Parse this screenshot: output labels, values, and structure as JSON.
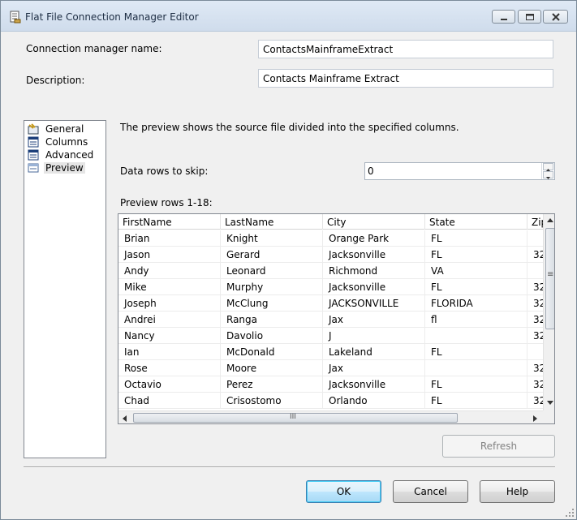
{
  "window": {
    "title": "Flat File Connection Manager Editor"
  },
  "form": {
    "connection_name_label": "Connection manager name:",
    "connection_name_value": "ContactsMainframeExtract",
    "description_label": "Description:",
    "description_value": "Contacts Mainframe Extract"
  },
  "nav": {
    "items": [
      {
        "label": "General",
        "icon": "general-icon"
      },
      {
        "label": "Columns",
        "icon": "columns-icon"
      },
      {
        "label": "Advanced",
        "icon": "advanced-icon"
      },
      {
        "label": "Preview",
        "icon": "preview-icon"
      }
    ],
    "selected": "Preview"
  },
  "preview": {
    "intro": "The preview shows the source file divided into the specified columns.",
    "skip_label": "Data rows to skip:",
    "skip_value": "0",
    "rows_label": "Preview rows 1-18:",
    "columns": [
      "FirstName",
      "LastName",
      "City",
      "State",
      "Zip"
    ],
    "rows": [
      [
        "Brian",
        "Knight",
        "Orange Park",
        "FL",
        ""
      ],
      [
        "Jason",
        "Gerard",
        "Jacksonville",
        "FL",
        "32"
      ],
      [
        "Andy",
        "Leonard",
        "Richmond",
        "VA",
        ""
      ],
      [
        "Mike",
        "Murphy",
        "Jacksonville",
        "FL",
        "32"
      ],
      [
        "Joseph",
        "McClung",
        "JACKSONVILLE",
        "FLORIDA",
        "32"
      ],
      [
        "Andrei",
        "Ranga",
        "Jax",
        "fl",
        "32"
      ],
      [
        "Nancy",
        "Davolio",
        "J",
        "",
        "32"
      ],
      [
        "Ian",
        "McDonald",
        "Lakeland",
        "FL",
        ""
      ],
      [
        "Rose",
        "Moore",
        "Jax",
        "",
        "32"
      ],
      [
        "Octavio",
        "Perez",
        "Jacksonville",
        "FL",
        "32"
      ],
      [
        "Chad",
        "Crisostomo",
        "Orlando",
        "FL",
        "32"
      ]
    ],
    "hscroll_glyph": "III",
    "vscroll_glyph": "≡"
  },
  "buttons": {
    "refresh": "Refresh",
    "ok": "OK",
    "cancel": "Cancel",
    "help": "Help"
  }
}
